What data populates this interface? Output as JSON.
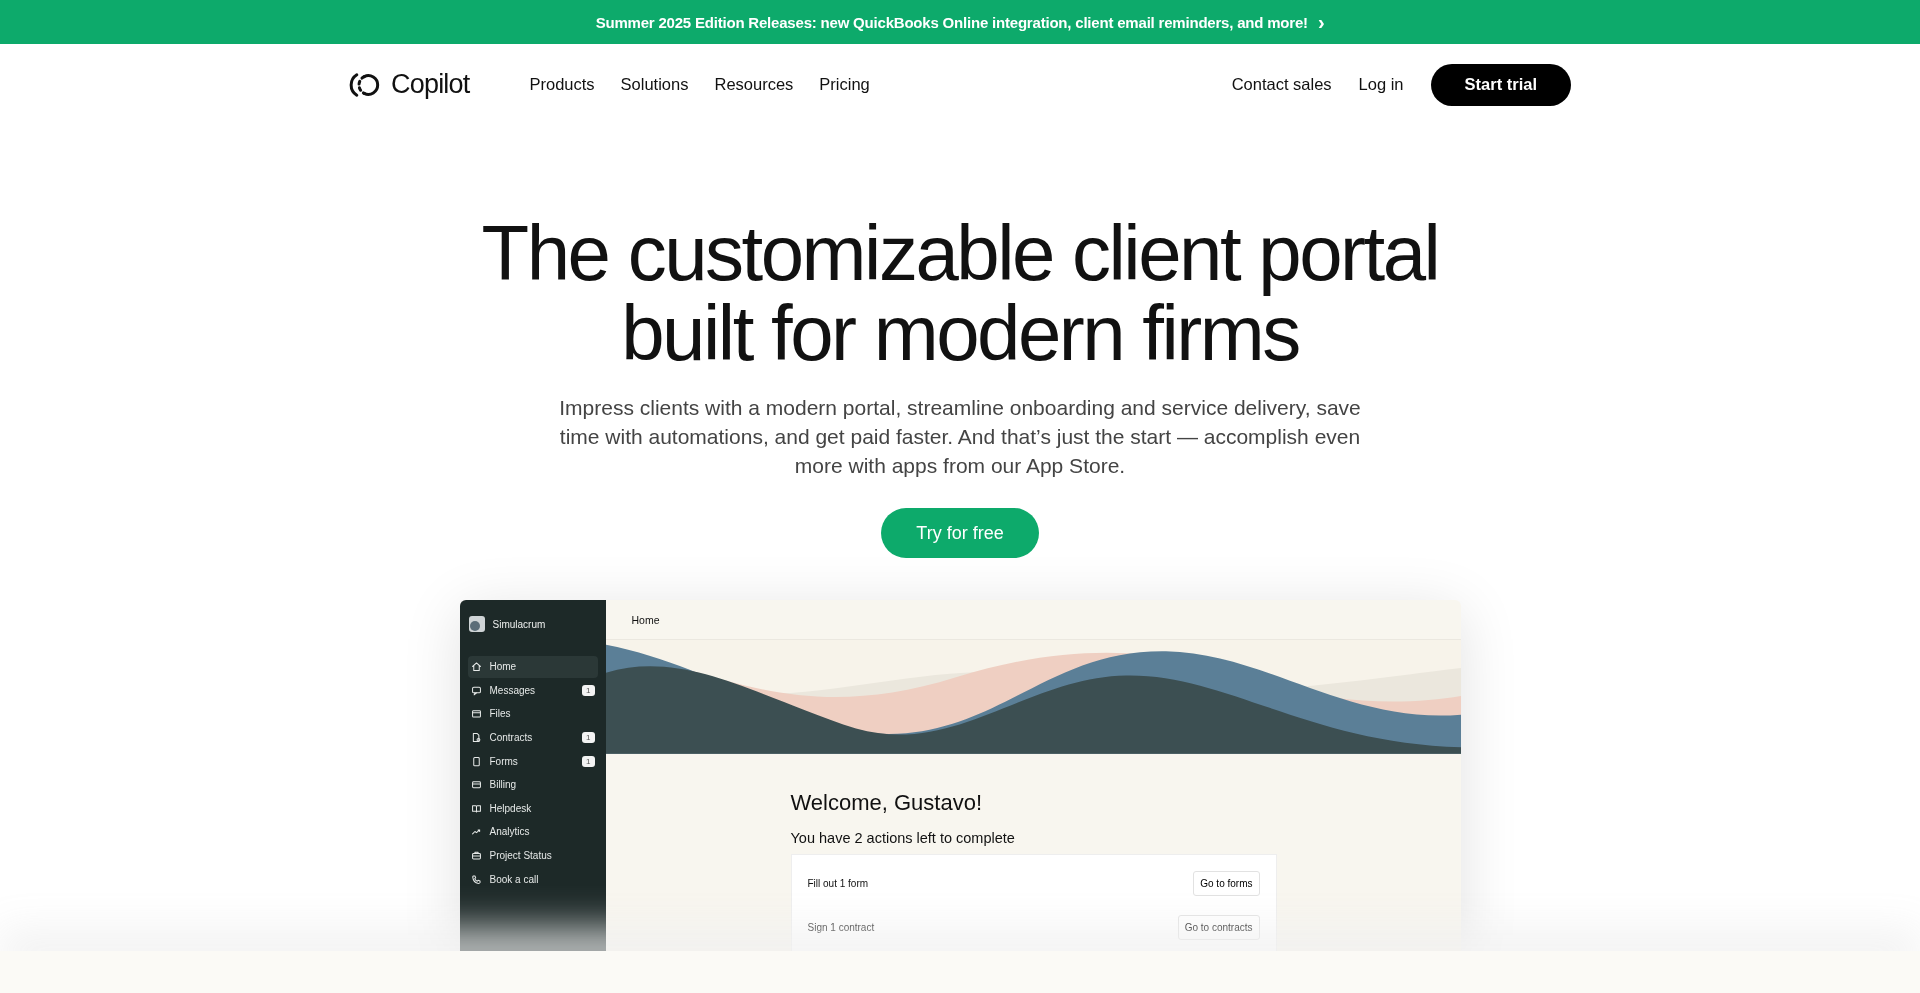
{
  "announcement": {
    "text": "Summer 2025 Edition Releases: new QuickBooks Online integration, client email reminders, and more!",
    "arrow": "›"
  },
  "nav": {
    "logo": "Copilot",
    "links": [
      "Products",
      "Solutions",
      "Resources",
      "Pricing"
    ],
    "right_links": [
      "Contact sales",
      "Log in"
    ],
    "cta": "Start trial"
  },
  "hero": {
    "title": "The customizable client portal built for modern firms",
    "subtitle": "Impress clients with a modern portal, streamline onboarding and service delivery, save time with automations, and get paid faster. And that’s just the start — accomplish even more with apps from our App Store.",
    "button": "Try for free"
  },
  "app_preview": {
    "workspace": "Simulacrum",
    "page_title": "Home",
    "sidebar_items": [
      {
        "label": "Home",
        "selected": true
      },
      {
        "label": "Messages",
        "selected": false,
        "badge": "1"
      },
      {
        "label": "Files",
        "selected": false
      },
      {
        "label": "Contracts",
        "selected": false,
        "badge": "1"
      },
      {
        "label": "Forms",
        "selected": false,
        "badge": "1"
      },
      {
        "label": "Billing",
        "selected": false
      },
      {
        "label": "Helpdesk",
        "selected": false
      },
      {
        "label": "Analytics",
        "selected": false
      },
      {
        "label": "Project Status",
        "selected": false
      },
      {
        "label": "Book a call",
        "selected": false
      }
    ],
    "welcome": "Welcome, Gustavo!",
    "actions_heading": "You have 2 actions left to complete",
    "actions": [
      {
        "label": "Fill out 1 form",
        "button": "Go to forms"
      },
      {
        "label": "Sign 1 contract",
        "button": "Go to contracts"
      }
    ]
  }
}
